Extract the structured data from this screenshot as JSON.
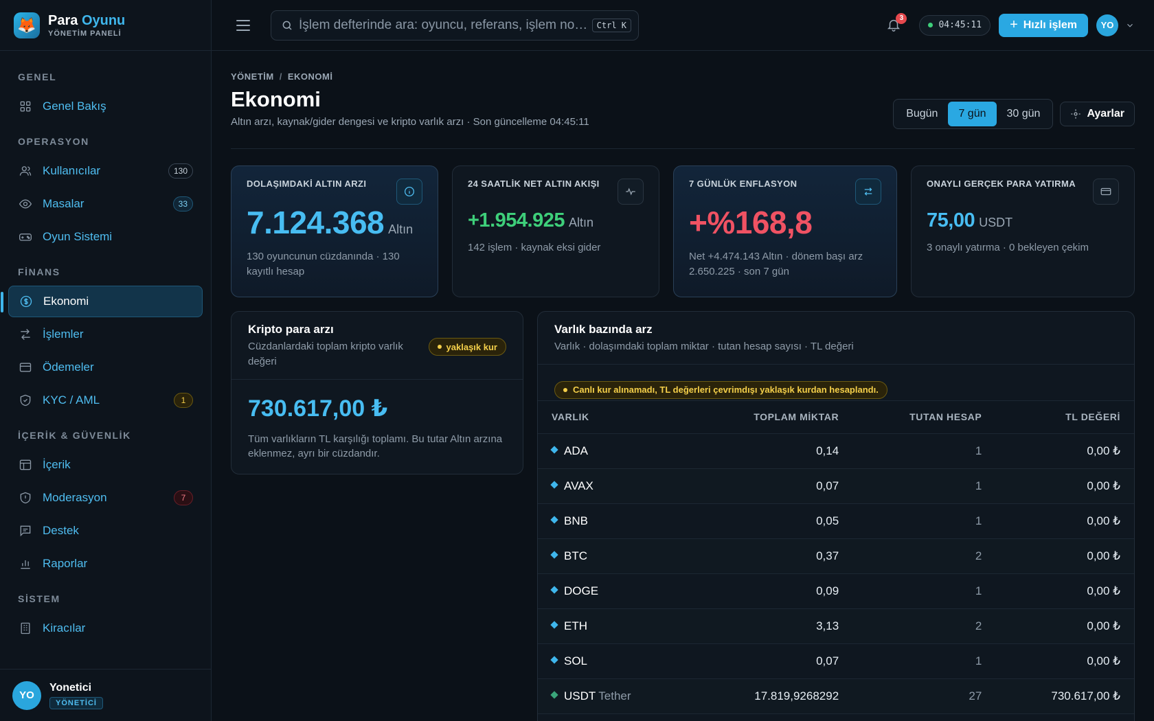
{
  "brand": {
    "name_a": "Para",
    "name_b": "Oyunu",
    "subtitle": "YÖNETİM PANELİ",
    "logo_icon": "fox-icon"
  },
  "sidebar": {
    "sections": [
      {
        "title": "GENEL",
        "items": [
          {
            "label": "Genel Bakış",
            "icon": "grid-icon",
            "badge": ""
          }
        ]
      },
      {
        "title": "OPERASYON",
        "items": [
          {
            "label": "Kullanıcılar",
            "icon": "users-icon",
            "badge": "130"
          },
          {
            "label": "Masalar",
            "icon": "eye-icon",
            "badge": "33"
          },
          {
            "label": "Oyun Sistemi",
            "icon": "gamepad-icon",
            "badge": ""
          }
        ]
      },
      {
        "title": "FİNANS",
        "items": [
          {
            "label": "Ekonomi",
            "icon": "coin-icon",
            "badge": "",
            "active": true
          },
          {
            "label": "İşlemler",
            "icon": "arrows-icon",
            "badge": ""
          },
          {
            "label": "Ödemeler",
            "icon": "card-icon",
            "badge": ""
          },
          {
            "label": "KYC / AML",
            "icon": "shield-check-icon",
            "badge": "1"
          }
        ]
      },
      {
        "title": "İÇERİK & GÜVENLİK",
        "items": [
          {
            "label": "İçerik",
            "icon": "layout-icon",
            "badge": ""
          },
          {
            "label": "Moderasyon",
            "icon": "shield-alert-icon",
            "badge": "7"
          },
          {
            "label": "Destek",
            "icon": "chat-icon",
            "badge": ""
          },
          {
            "label": "Raporlar",
            "icon": "bar-chart-icon",
            "badge": ""
          }
        ]
      },
      {
        "title": "SİSTEM",
        "items": [
          {
            "label": "Kiracılar",
            "icon": "building-icon",
            "badge": ""
          }
        ]
      }
    ],
    "user": {
      "initials": "YO",
      "name": "Yonetici",
      "role": "YÖNETİCİ"
    }
  },
  "topbar": {
    "search_placeholder": "İşlem defterinde ara: oyuncu, referans, işlem no…",
    "shortcut": "Ctrl K",
    "notif_count": "3",
    "clock": "04:45:11",
    "quick_action": "Hızlı işlem",
    "avatar": "YO"
  },
  "page": {
    "breadcrumb": [
      "YÖNETİM",
      "EKONOMİ"
    ],
    "title": "Ekonomi",
    "subtitle": "Altın arzı, kaynak/gider dengesi ve kripto varlık arzı · Son güncelleme 04:45:11",
    "ranges": [
      "Bugün",
      "7 gün",
      "30 gün"
    ],
    "active_range": "7 gün",
    "settings_label": "Ayarlar"
  },
  "stats": [
    {
      "label": "DOLAŞIMDAKİ ALTIN ARZI",
      "value": "7.124.368",
      "unit": "Altın",
      "desc": "130 oyuncunun cüzdanında · 130 kayıtlı hesap",
      "icon": "info-icon"
    },
    {
      "label": "24 SAATLİK NET ALTIN AKIŞI",
      "value": "+1.954.925",
      "unit": "Altın",
      "desc": "142 işlem · kaynak eksi gider",
      "icon": "pulse-icon"
    },
    {
      "label": "7 GÜNLÜK ENFLASYON",
      "value": "+%168,8",
      "unit": "",
      "desc": "Net +4.474.143 Altın · dönem başı arz 2.650.225 · son 7 gün",
      "icon": "swap-icon"
    },
    {
      "label": "ONAYLI GERÇEK PARA YATIRMA",
      "value": "75,00",
      "unit": "USDT",
      "desc": "3 onaylı yatırma · 0 bekleyen çekim",
      "icon": "card-icon"
    }
  ],
  "crypto": {
    "title": "Kripto para arzı",
    "subtitle": "Cüzdanlardaki toplam kripto varlık değeri",
    "badge": "yaklaşık kur",
    "total": "730.617,00 ₺",
    "note": "Tüm varlıkların TL karşılığı toplamı. Bu tutar Altın arzına eklenmez, ayrı bir cüzdandır."
  },
  "assets": {
    "title": "Varlık bazında arz",
    "subtitle": "Varlık · dolaşımdaki toplam miktar · tutan hesap sayısı · TL değeri",
    "warning": "Canlı kur alınamadı, TL değerleri çevrimdışı yaklaşık kurdan hesaplandı.",
    "columns": [
      "VARLIK",
      "TOPLAM MİKTAR",
      "TUTAN HESAP",
      "TL DEĞERİ"
    ],
    "rows": [
      {
        "asset": "ADA",
        "full": "",
        "amount": "0,14",
        "holders": "1",
        "tl": "0,00 ₺"
      },
      {
        "asset": "AVAX",
        "full": "",
        "amount": "0,07",
        "holders": "1",
        "tl": "0,00 ₺"
      },
      {
        "asset": "BNB",
        "full": "",
        "amount": "0,05",
        "holders": "1",
        "tl": "0,00 ₺"
      },
      {
        "asset": "BTC",
        "full": "",
        "amount": "0,37",
        "holders": "2",
        "tl": "0,00 ₺"
      },
      {
        "asset": "DOGE",
        "full": "",
        "amount": "0,09",
        "holders": "1",
        "tl": "0,00 ₺"
      },
      {
        "asset": "ETH",
        "full": "",
        "amount": "3,13",
        "holders": "2",
        "tl": "0,00 ₺"
      },
      {
        "asset": "SOL",
        "full": "",
        "amount": "0,07",
        "holders": "1",
        "tl": "0,00 ₺"
      },
      {
        "asset": "USDT",
        "full": "Tether",
        "amount": "17.819,9268292",
        "holders": "27",
        "tl": "730.617,00 ₺"
      }
    ]
  }
}
